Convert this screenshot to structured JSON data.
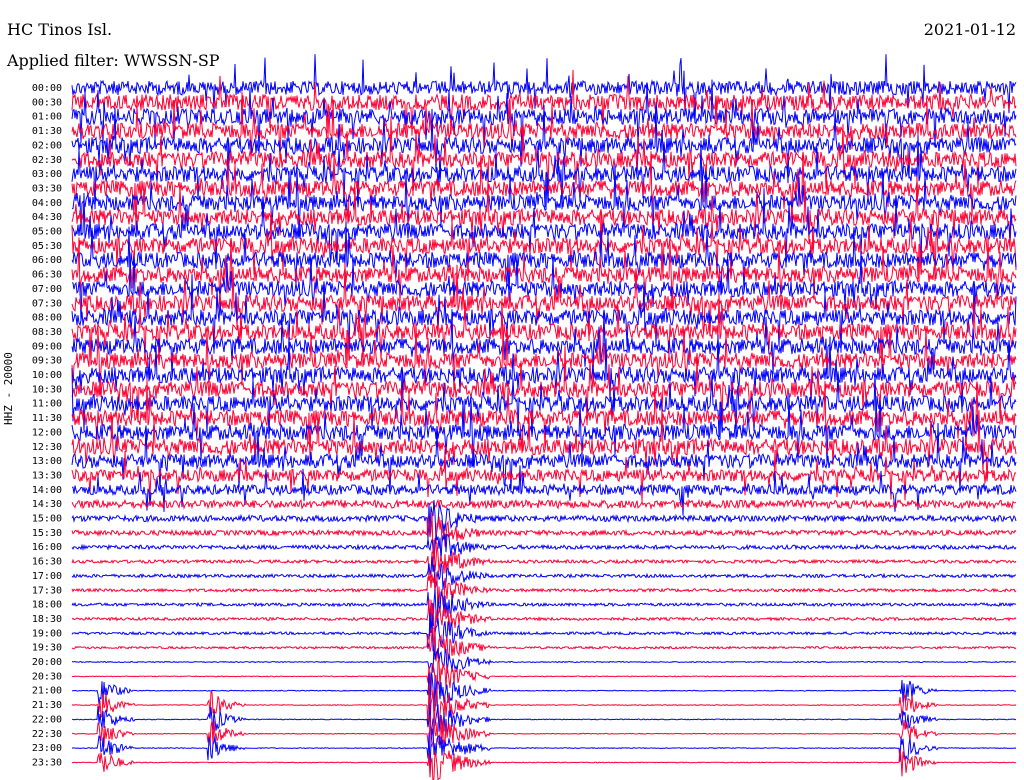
{
  "header": {
    "station": "HC Tinos Isl.",
    "date": "2021-01-12",
    "filter": "Applied filter: WWSSN-SP",
    "channel": "HHZ - 20000"
  },
  "colors": {
    "even": "#0000ff",
    "odd": "#ff0033"
  },
  "chart_data": {
    "type": "helicorder",
    "tick_labels": [
      "00:00",
      "00:30",
      "01:00",
      "01:30",
      "02:00",
      "02:30",
      "03:00",
      "03:30",
      "04:00",
      "04:30",
      "05:00",
      "05:30",
      "06:00",
      "06:30",
      "07:00",
      "07:30",
      "08:00",
      "08:30",
      "09:00",
      "09:30",
      "10:00",
      "10:30",
      "11:00",
      "11:30",
      "12:00",
      "12:30",
      "13:00",
      "13:30",
      "14:00",
      "14:30",
      "15:00",
      "15:30",
      "16:00",
      "16:30",
      "17:00",
      "17:30",
      "18:00",
      "18:30",
      "19:00",
      "19:30",
      "20:00",
      "20:30",
      "21:00",
      "21:30",
      "22:00",
      "22:30",
      "23:00",
      "23:30"
    ],
    "amplitude": [
      7,
      8,
      8,
      8,
      8,
      8,
      8,
      8,
      8,
      8,
      8,
      8,
      8,
      8,
      8,
      8,
      8,
      8,
      8,
      8,
      8,
      8,
      8,
      8,
      8,
      8,
      7,
      6,
      5,
      4,
      3,
      2.5,
      2,
      1.6,
      1.6,
      1.5,
      1.5,
      1.4,
      1.3,
      1.1,
      0.5,
      0.4,
      0.4,
      0.4,
      0.4,
      0.4,
      0.4,
      0.4
    ],
    "events": [
      {
        "trace_start": 30,
        "trace_end": 47,
        "minute": 11.5,
        "label": "large-event"
      },
      {
        "trace_start": 42,
        "trace_end": 47,
        "minute": 1,
        "label": "event-left"
      },
      {
        "trace_start": 43,
        "trace_end": 46,
        "minute": 4.5,
        "label": "event-mid"
      },
      {
        "trace_start": 42,
        "trace_end": 47,
        "minute": 26.5,
        "label": "event-right"
      }
    ]
  }
}
